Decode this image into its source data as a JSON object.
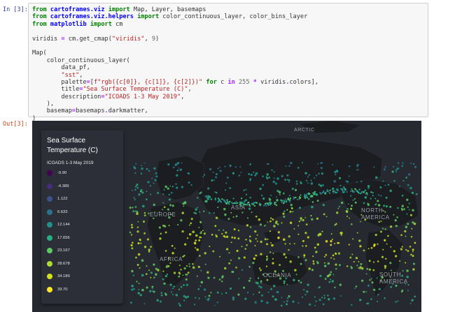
{
  "cell": {
    "in_prompt": "In [3]:",
    "out_prompt": "Out[3]:"
  },
  "map": {
    "labels": {
      "arctic": "ARCTIC",
      "asia": "ASIA",
      "europe": "EUROPE",
      "north_america": "NORTH AMERICA",
      "africa": "AFRICA",
      "oceania": "OCEANIA",
      "south_america": "SOUTH AMERICA"
    },
    "legend": {
      "title": "Sea Surface Temperature (C)",
      "description": "ICOADS 1-3 May 2019",
      "items": [
        {
          "label": "-9.90",
          "color": "#440154"
        },
        {
          "label": "-4.389",
          "color": "#472d7b"
        },
        {
          "label": "1.122",
          "color": "#3b528b"
        },
        {
          "label": "6.633",
          "color": "#2c728e"
        },
        {
          "label": "12.144",
          "color": "#21918c"
        },
        {
          "label": "17.656",
          "color": "#28ae80"
        },
        {
          "label": "23.167",
          "color": "#5ec962"
        },
        {
          "label": "28.678",
          "color": "#addc30"
        },
        {
          "label": "34.189",
          "color": "#d2e21b"
        },
        {
          "label": "39.70",
          "color": "#fde725"
        }
      ]
    }
  }
}
